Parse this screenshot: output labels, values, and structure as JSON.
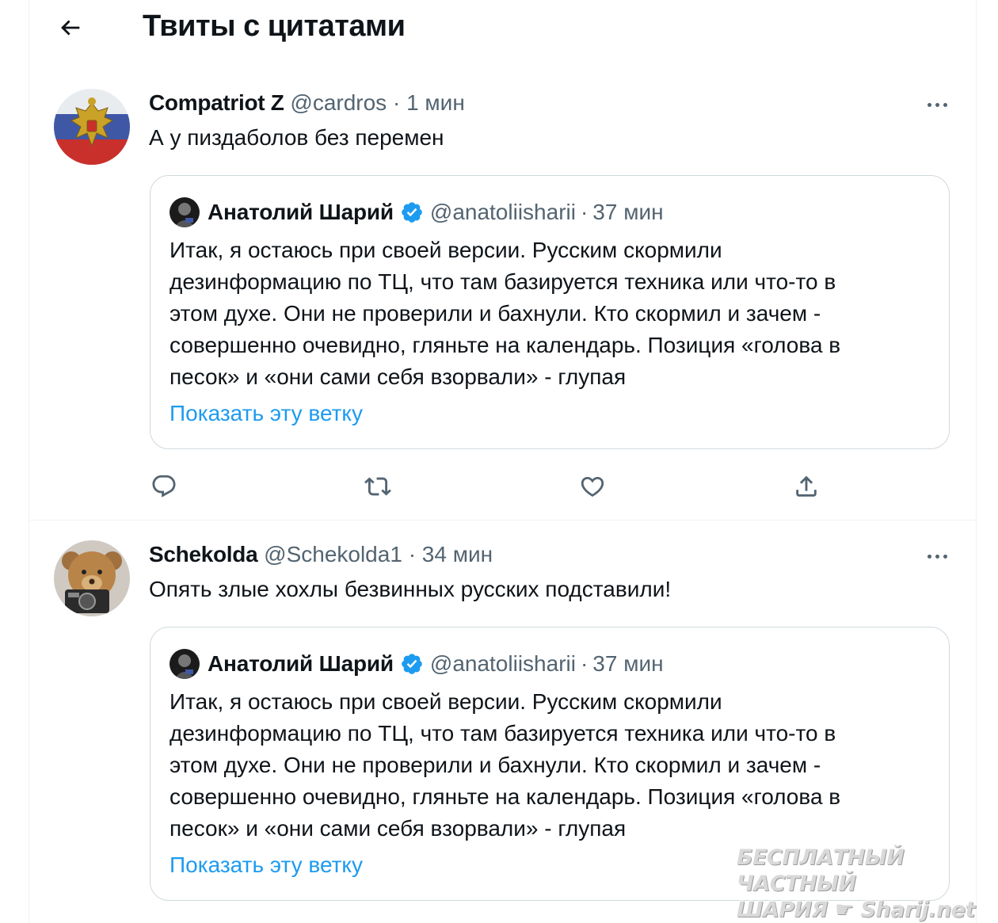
{
  "header": {
    "title": "Твиты с цитатами",
    "back_icon": "arrow-left-icon"
  },
  "tweets": [
    {
      "name": "Compatriot Z",
      "handle": "@cardros",
      "separator": "·",
      "time": "1 мин",
      "text": "А у пиздаболов без перемен",
      "avatar_icon": "double-headed-eagle-avatar",
      "quote": {
        "name": "Анатолий Шарий",
        "handle": "@anatoliisharii",
        "separator": "·",
        "time": "37 мин",
        "lines": [
          "Итак, я остаюсь при своей версии. Русским скормили",
          "дезинформацию по ТЦ, что там базируется техника или что-то в",
          "этом духе. Они не проверили и бахнули. Кто скормил и зачем -",
          "совершенно очевидно, гляньте на календарь. Позиция «голова в",
          "песок» и «они сами себя взорвали» - глупая"
        ],
        "link": "Показать эту ветку"
      },
      "actions": [
        "reply-icon",
        "retweet-icon",
        "like-icon",
        "share-icon"
      ]
    },
    {
      "name": "Schekolda",
      "handle": "@Schekolda1",
      "separator": "·",
      "time": "34 мин",
      "text": "Опять злые хохлы безвинных русских подставили!",
      "avatar_icon": "teddy-bear-avatar",
      "quote": {
        "name": "Анатолий Шарий",
        "handle": "@anatoliisharii",
        "separator": "·",
        "time": "37 мин",
        "lines": [
          "Итак, я остаюсь при своей версии. Русским скормили",
          "дезинформацию по ТЦ, что там базируется техника или что-то в",
          "этом духе. Они не проверили и бахнули. Кто скормил и зачем -",
          "совершенно очевидно, гляньте на календарь. Позиция «голова в",
          "песок» и «они сами себя взорвали» - глупая"
        ],
        "link": "Показать эту ветку"
      }
    }
  ],
  "watermark": {
    "line1": "БЕСПЛАТНЫЙ ЧАСТНЫЙ",
    "line2_left": "ШАРИЯ",
    "line2_right": "Sharij.net"
  },
  "colors": {
    "link": "#1d9bf0",
    "secondary_text": "#536471",
    "border": "#cfd9de",
    "verified": "#1d9bf0"
  }
}
